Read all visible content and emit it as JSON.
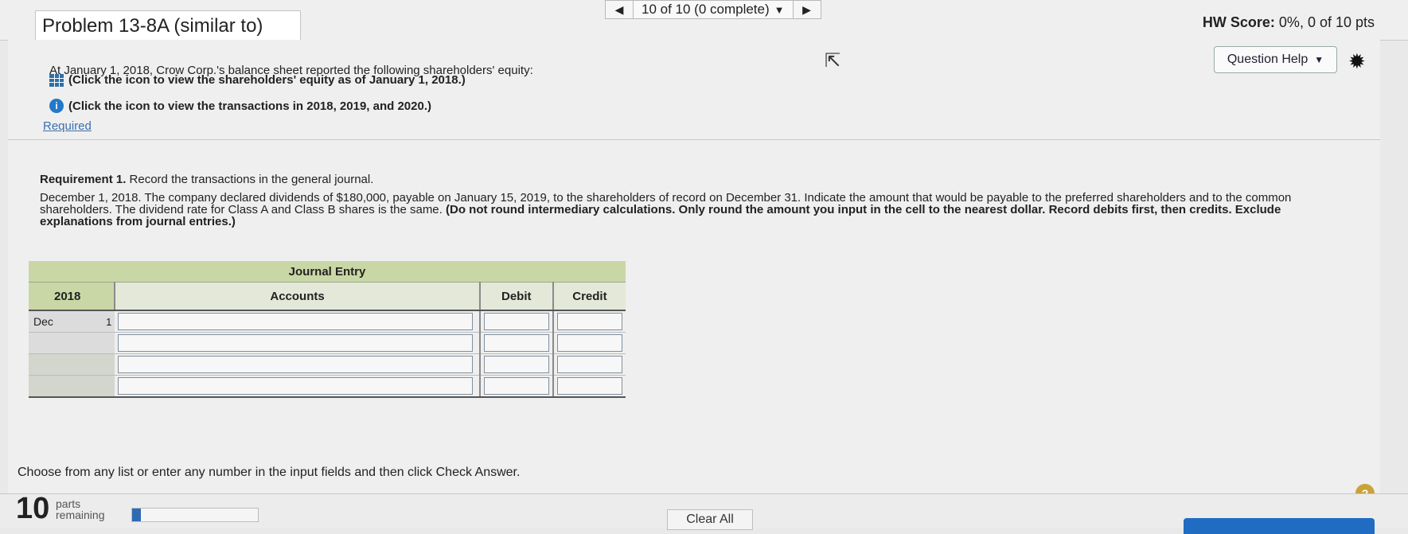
{
  "nav": {
    "prev_icon": "triangle-left",
    "label": "10 of 10 (0 complete)",
    "caret": "▼",
    "next_icon": "triangle-right"
  },
  "header": {
    "title": "Problem 13-8A (similar to)",
    "score_label": "HW Score:",
    "score_value": "0%, 0 of 10 pts"
  },
  "toolbar": {
    "question_help": "Question Help",
    "question_help_caret": "▼",
    "settings_icon": "gear-icon"
  },
  "question": {
    "intro": "At January 1, 2018, Crow Corp.'s balance sheet reported the following shareholders' equity:",
    "link1": "(Click the icon to view the shareholders' equity as of January 1, 2018.)",
    "link2": "(Click the icon to view the transactions in 2018, 2019, and 2020.)",
    "required": "Required",
    "req_label": "Requirement 1.",
    "req_text": " Record the transactions in the general journal.",
    "instr_plain": "December 1, 2018. The company declared dividends of $180,000, payable on January 15, 2019, to the shareholders of record on December 31. Indicate the amount that would be payable to the preferred shareholders and to the common shareholders. The dividend rate for Class A and Class B shares is the same. ",
    "instr_bold": "(Do not round intermediary calculations. Only round the amount you input in the cell to the nearest dollar. Record debits first, then credits. Exclude explanations from journal entries.)"
  },
  "journal": {
    "caption": "Journal Entry",
    "year": "2018",
    "col_accounts": "Accounts",
    "col_debit": "Debit",
    "col_credit": "Credit",
    "month": "Dec",
    "day": "1"
  },
  "footer": {
    "instruction": "Choose from any list or enter any number in the input fields and then click Check Answer.",
    "parts_count": "10",
    "parts_label1": "parts",
    "parts_label2": "remaining",
    "progress_fraction": 0.07,
    "clear_all": "Clear All",
    "help_glyph": "?"
  },
  "colors": {
    "accent_blue": "#1f6cc2",
    "journal_header": "#c9d7a6",
    "help_gold": "#c9a23a"
  }
}
